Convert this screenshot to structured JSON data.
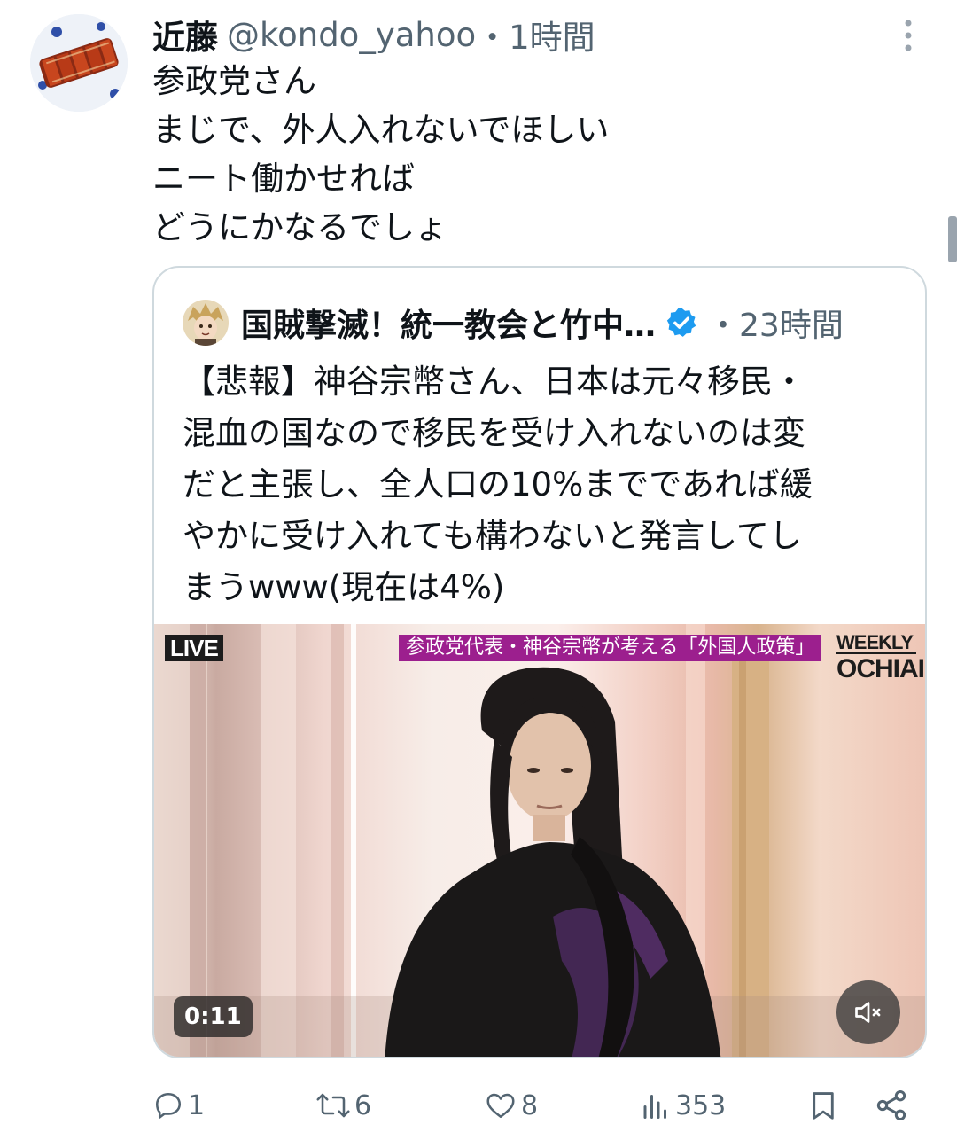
{
  "tweet": {
    "display_name": "近藤",
    "handle": "@kondo_yahoo",
    "time": "・1時間",
    "text_lines": [
      "参政党さん",
      "まじで、外人入れないでほしい",
      "ニート働かせれば",
      "どうにかなるでしょ"
    ],
    "avatar_icon": "food-photo-avatar",
    "more_icon": "more-vertical-icon"
  },
  "quote": {
    "display_name": "国賊撃滅！統一教会と竹中…",
    "verified_icon": "verified-badge-icon",
    "verified_color": "#1d9bf0",
    "time": "・23時間",
    "text_lines": [
      "【悲報】神谷宗幣さん、日本は元々移民・",
      "混血の国なので移民を受け入れないのは変",
      "だと主張し、全人口の10%までであれば緩",
      "やかに受け入れても構わないと発言してし",
      "まうwww(現在は4%)"
    ],
    "media": {
      "live_label": "LIVE",
      "caption": "参政党代表・神谷宗幣が考える「外国人政策」",
      "brand_top": "WEEKLY",
      "brand_bottom": "OCHIAI",
      "duration": "0:11",
      "mute_icon": "speaker-muted-icon"
    }
  },
  "actions": {
    "reply_count": "1",
    "retweet_count": "6",
    "like_count": "8",
    "view_count": "353"
  },
  "colors": {
    "text": "#0f1419",
    "secondary": "#536471",
    "border": "#cfd9de",
    "caption_bg": "#9c1f8e"
  }
}
